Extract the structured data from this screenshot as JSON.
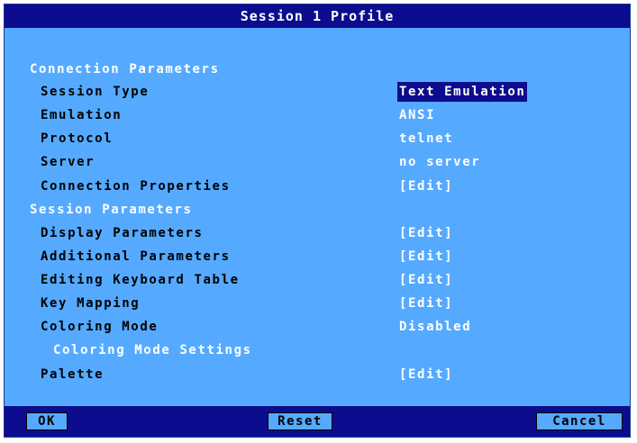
{
  "window": {
    "title": "Session 1 Profile"
  },
  "connection": {
    "section_label": "Connection Parameters",
    "session_type": {
      "label": "Session Type",
      "value": "Text Emulation"
    },
    "emulation": {
      "label": "Emulation",
      "value": "ANSI"
    },
    "protocol": {
      "label": "Protocol",
      "value": "telnet"
    },
    "server": {
      "label": "Server",
      "value": "no server"
    },
    "connection_properties": {
      "label": "Connection Properties",
      "value": "[Edit]"
    }
  },
  "session": {
    "section_label": "Session Parameters",
    "display_parameters": {
      "label": "Display Parameters",
      "value": "[Edit]"
    },
    "additional_parameters": {
      "label": "Additional Parameters",
      "value": "[Edit]"
    },
    "editing_keyboard_table": {
      "label": "Editing Keyboard Table",
      "value": "[Edit]"
    },
    "key_mapping": {
      "label": "Key Mapping",
      "value": "[Edit]"
    },
    "coloring_mode": {
      "label": "Coloring Mode",
      "value": "Disabled"
    },
    "coloring_mode_settings": {
      "label": "Coloring Mode Settings"
    },
    "palette": {
      "label": "Palette",
      "value": "[Edit]"
    }
  },
  "footer": {
    "ok_label": "OK",
    "reset_label": "Reset",
    "cancel_label": "Cancel"
  },
  "colors": {
    "background": "#55aaff",
    "title_bar": "#0c0c8e",
    "selected_value_bg": "#0c0c8e",
    "text_white": "#ffffff",
    "text_black": "#000000"
  }
}
